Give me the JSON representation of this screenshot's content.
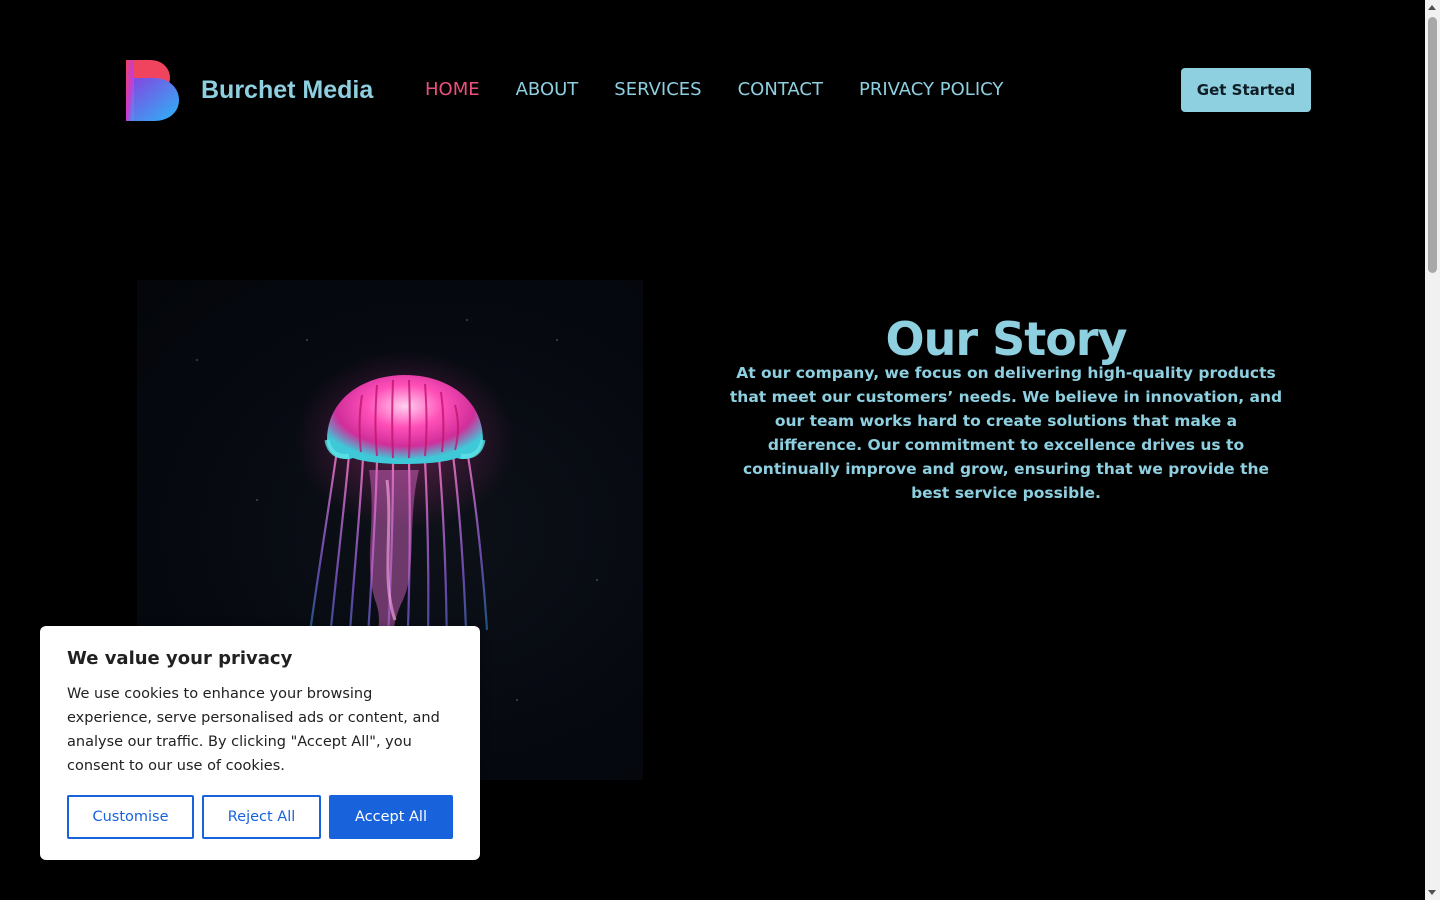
{
  "header": {
    "brand": "Burchet Media",
    "logo_icon": "brand-b-logo",
    "nav": [
      {
        "label": "HOME",
        "active": true
      },
      {
        "label": "ABOUT",
        "active": false
      },
      {
        "label": "SERVICES",
        "active": false
      },
      {
        "label": "CONTACT",
        "active": false
      },
      {
        "label": "PRIVACY POLICY",
        "active": false
      }
    ],
    "cta_label": "Get Started"
  },
  "story": {
    "title": "Our Story",
    "body": "At our company, we focus on delivering high-quality products that meet our customers’ needs. We believe in innovation, and our team works hard to create solutions that make a difference. Our commitment to excellence drives us to continually improve and grow, ensuring that we provide the best service possible."
  },
  "hero_image": {
    "subject": "glowing pink and blue jellyfish on dark background"
  },
  "cookie_banner": {
    "title": "We value your privacy",
    "text": "We use cookies to enhance your browsing experience, serve personalised ads or content, and analyse our traffic. By clicking \"Accept All\", you consent to our use of cookies.",
    "customise_label": "Customise",
    "reject_label": "Reject All",
    "accept_label": "Accept All"
  },
  "colors": {
    "background": "#000000",
    "accent": "#8ecfe0",
    "active_nav": "#ec4f7d",
    "cookie_button": "#1863dc"
  }
}
